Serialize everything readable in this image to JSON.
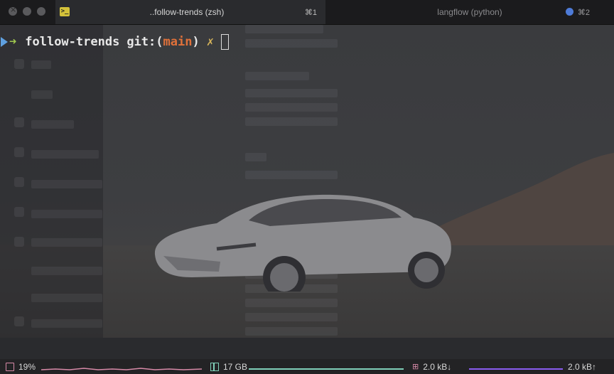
{
  "tabs": [
    {
      "title": "..follow-trends (zsh)",
      "shortcut": "⌘1",
      "icon": "terminal-icon",
      "active": true
    },
    {
      "title": "langflow (python)",
      "shortcut": "⌘2",
      "icon": "blue-dot-icon",
      "active": false
    }
  ],
  "prompt": {
    "directory": "follow-trends",
    "git_prefix": "git:(",
    "branch": "main",
    "git_suffix": ")",
    "dirty_marker": "✗"
  },
  "status": {
    "cpu": "19%",
    "memory": "17 GB",
    "net_down": "2.0 kB↓",
    "net_up": "2.0 kB↑"
  },
  "colors": {
    "accent_blue": "#4e7bd8",
    "prompt_green": "#a0c84f",
    "branch_orange": "#e0713a",
    "dirty_yellow": "#d6b45a",
    "cpu_pink": "#d88aa8",
    "mem_teal": "#7fcfb8",
    "net_purple": "#8a5cf0"
  }
}
